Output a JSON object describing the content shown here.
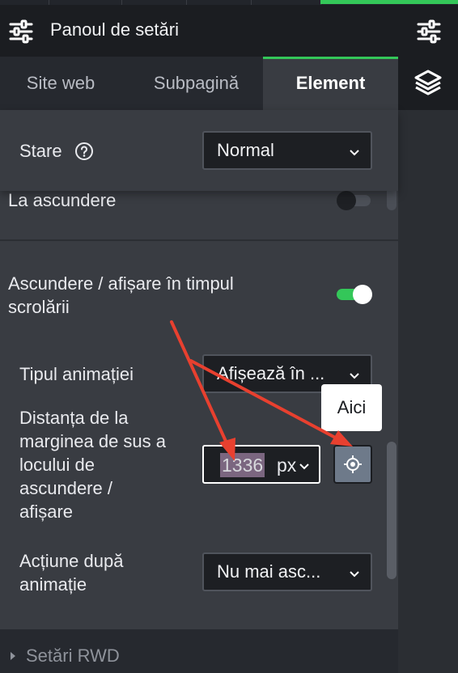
{
  "header": {
    "title": "Panoul de setări",
    "left_icon": "sliders-icon",
    "right_icon": "sliders-icon"
  },
  "tabs": [
    {
      "label": "Site web",
      "active": false
    },
    {
      "label": "Subpagină",
      "active": false
    },
    {
      "label": "Element",
      "active": true
    }
  ],
  "right_panel": {
    "icon": "layers-icon"
  },
  "state": {
    "label": "Stare",
    "help_icon": "help-circle-icon",
    "value": "Normal"
  },
  "on_hide": {
    "label": "La ascundere",
    "enabled": false
  },
  "scroll_hide": {
    "label_line1": "Ascundere / afișare în timpul",
    "label_line2": "scrolării",
    "enabled": true
  },
  "animation_type": {
    "label": "Tipul animației",
    "value": "Afișează în ..."
  },
  "distance": {
    "label_lines": [
      "Distanța de la",
      "marginea de sus a",
      "locului de",
      "ascundere /",
      "afișare"
    ],
    "value": "1336",
    "unit": "px",
    "target_icon": "crosshair-icon"
  },
  "tooltip": "Aici",
  "after_animation": {
    "label_line1": "Acțiune după",
    "label_line2": "animație",
    "value": "Nu mai asc..."
  },
  "footer_section": {
    "label": "Setări RWD"
  },
  "colors": {
    "accent": "#34c759",
    "annotation_arrow": "#e8402f",
    "background": "#393c42",
    "header": "#1b1d21"
  }
}
